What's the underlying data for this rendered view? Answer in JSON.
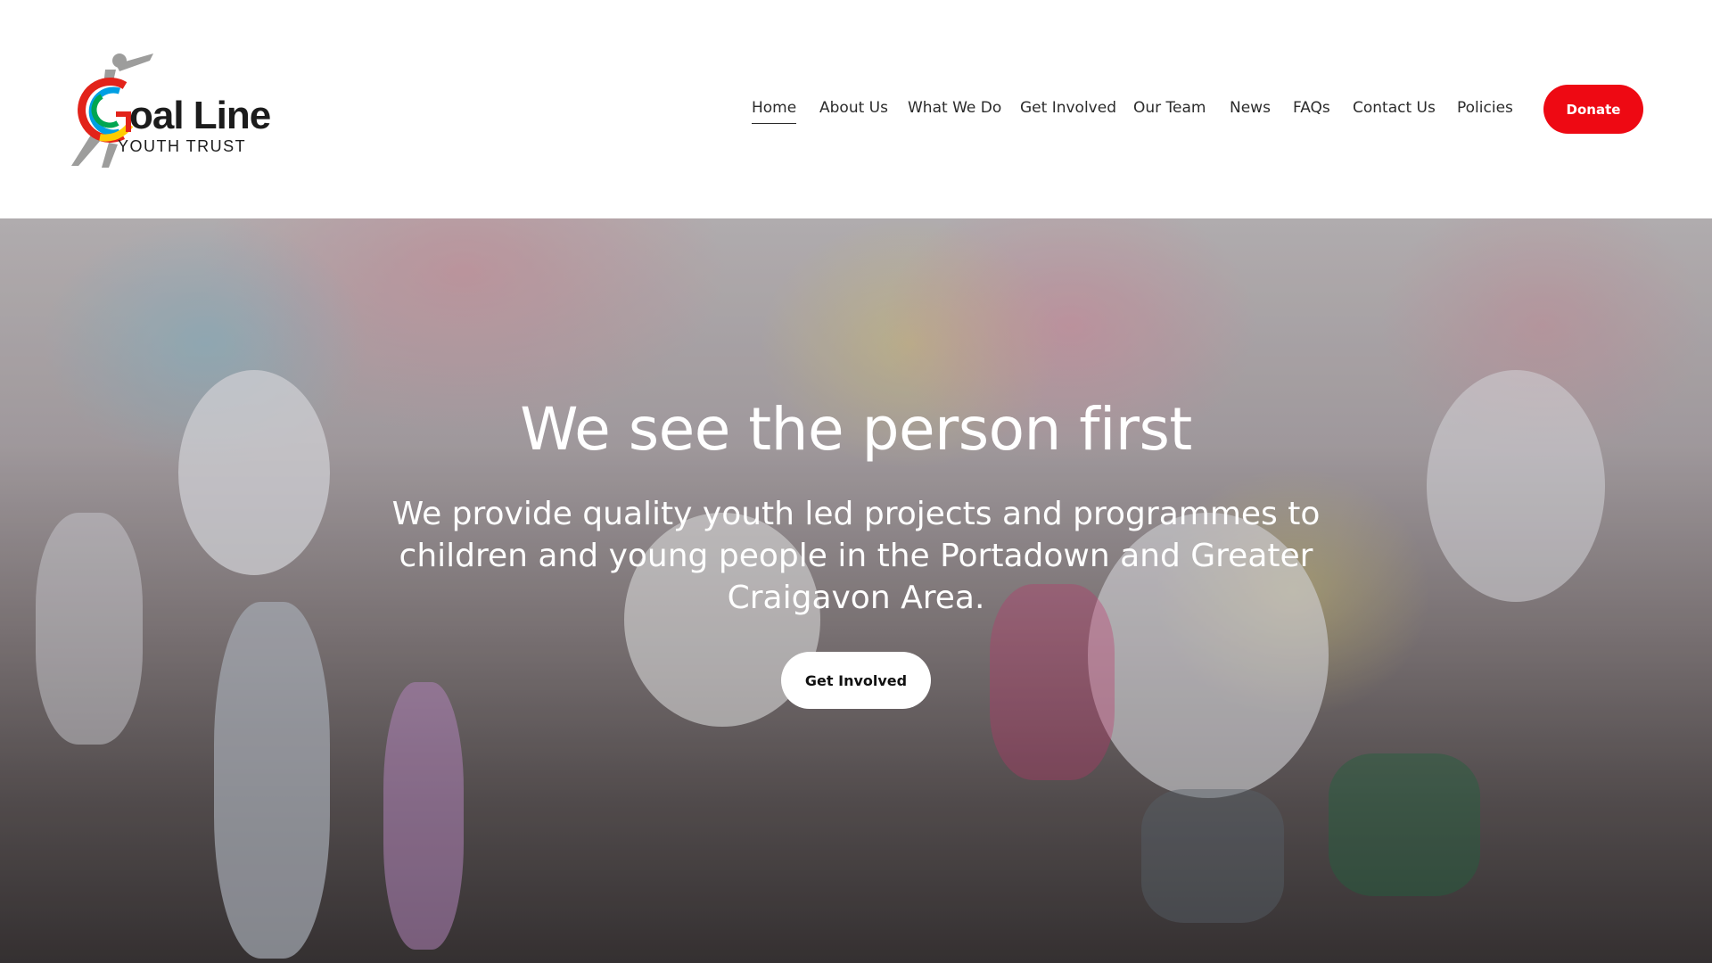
{
  "logo": {
    "title": "oal Line",
    "subtitle": "YOUTH TRUST",
    "icon": "goal-line-logo-icon",
    "colors": [
      "#e2231a",
      "#009fe3",
      "#ffcc00",
      "#00a651",
      "#9d9d9c"
    ]
  },
  "nav": {
    "items": [
      {
        "label": "Home",
        "active": true
      },
      {
        "label": "About Us"
      },
      {
        "label": "What We Do"
      },
      {
        "label": "Get Involved"
      },
      {
        "label": "Our Team"
      },
      {
        "label": "News"
      },
      {
        "label": "FAQs"
      },
      {
        "label": "Contact Us"
      },
      {
        "label": "Policies"
      }
    ],
    "donate_label": "Donate",
    "donate_color": "#ee0913"
  },
  "hero": {
    "title": "We see the person first",
    "subtitle": "We provide quality youth led projects and programmes to children and young people in the Portadown and Greater Craigavon Area.",
    "cta_label": "Get Involved",
    "image": "children-throwing-colored-powder-photo"
  }
}
